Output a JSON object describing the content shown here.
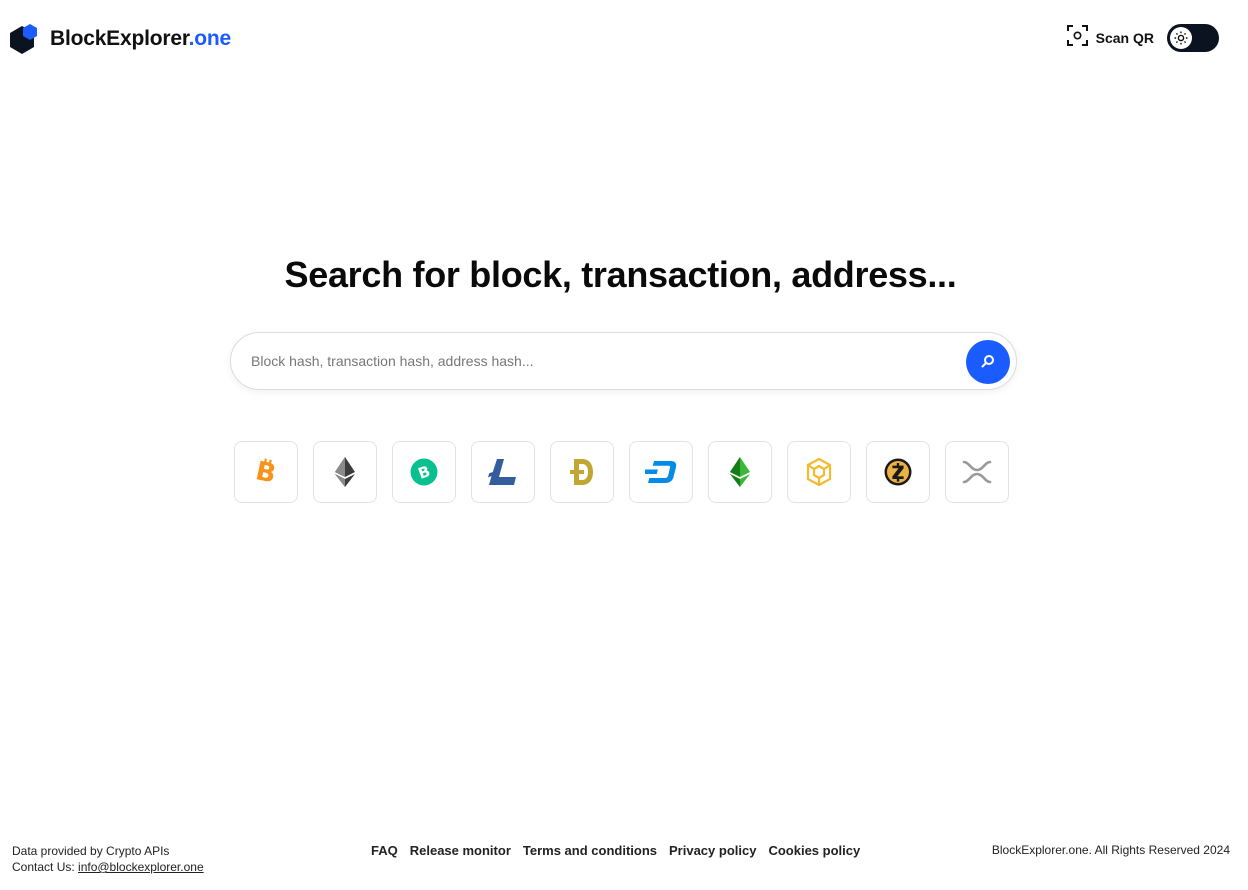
{
  "header": {
    "brand_main": "BlockExplorer",
    "brand_accent": ".one",
    "scan_qr_label": "Scan QR",
    "accent_color": "#1a5cff"
  },
  "hero": {
    "title": "Search for block, transaction, address..."
  },
  "search": {
    "placeholder": "Block hash, transaction hash, address hash...",
    "value": ""
  },
  "coins": [
    {
      "name": "bitcoin",
      "icon": "bitcoin-icon",
      "color": "#f7931a"
    },
    {
      "name": "ethereum",
      "icon": "ethereum-icon",
      "color": "#3c3c3d"
    },
    {
      "name": "bitcoin-cash",
      "icon": "bitcoin-cash-icon",
      "color": "#0ac18e"
    },
    {
      "name": "litecoin",
      "icon": "litecoin-icon",
      "color": "#345d9d"
    },
    {
      "name": "dogecoin",
      "icon": "dogecoin-icon",
      "color": "#c2a633"
    },
    {
      "name": "dash",
      "icon": "dash-icon",
      "color": "#008ce7"
    },
    {
      "name": "ethereum-classic",
      "icon": "ethereum-classic-icon",
      "color": "#3ab83a"
    },
    {
      "name": "bnb",
      "icon": "bnb-icon",
      "color": "#f3ba2f"
    },
    {
      "name": "zcash",
      "icon": "zcash-icon",
      "color": "#ecb244"
    },
    {
      "name": "xrp",
      "icon": "xrp-icon",
      "color": "#9a9a9a"
    }
  ],
  "footer": {
    "data_provided": "Data provided by Crypto APIs",
    "contact_label": "Contact Us: ",
    "contact_email": "info@blockexplorer.one",
    "links": [
      "FAQ",
      "Release monitor",
      "Terms and conditions",
      "Privacy policy",
      "Cookies policy"
    ],
    "copyright": "BlockExplorer.one. All Rights Reserved 2024"
  }
}
